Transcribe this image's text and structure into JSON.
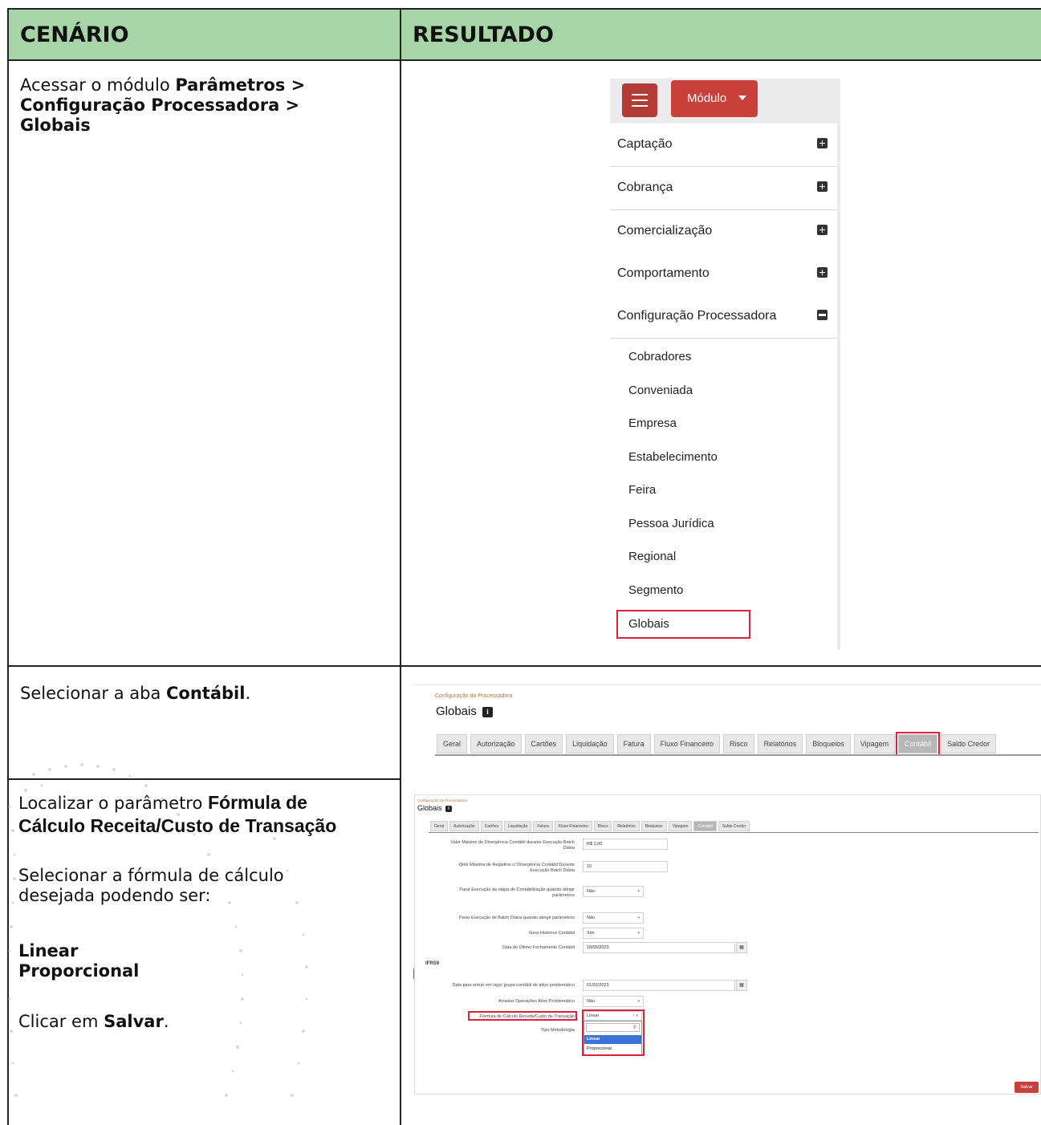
{
  "headers": {
    "scenario": "CENÁRIO",
    "result": "RESULTADO"
  },
  "rows": [
    {
      "instruction": {
        "prefix": "Acessar o módulo ",
        "bold_path": [
          "Parâmetros >",
          "Configuração Processadora >",
          "Globais"
        ]
      }
    },
    {
      "instruction": {
        "prefix": "Selecionar a aba ",
        "bold": "Contábil",
        "suffix": "."
      }
    },
    {
      "instruction": {
        "line1_prefix": "Localizar o parâmetro ",
        "line1_bold": "Fórmula de",
        "line2_bold": "Cálculo Receita/Custo de Transação",
        "select_text_1": "Selecionar a fórmula de cálculo",
        "select_text_2": "desejada podendo ser:",
        "options": [
          "Linear",
          "Proporcional"
        ],
        "click_prefix": "Clicar em ",
        "click_bold": "Salvar",
        "click_suffix": "."
      }
    }
  ],
  "menu": {
    "module_button": "Módulo",
    "items": [
      {
        "label": "Captação",
        "state": "plus"
      },
      {
        "label": "Cobrança",
        "state": "plus"
      },
      {
        "label": "Comercialização",
        "state": "plus"
      },
      {
        "label": "Comportamento",
        "state": "plus"
      },
      {
        "label": "Configuração Processadora",
        "state": "minus"
      }
    ],
    "subitems": [
      "Cobradores",
      "Conveniada",
      "Empresa",
      "Estabelecimento",
      "Feira",
      "Pessoa Jurídica",
      "Regional",
      "Segmento",
      "Globais"
    ],
    "highlighted": "Globais"
  },
  "page": {
    "breadcrumb": "Configuração da Processadora",
    "title": "Globais",
    "info_icon": "i",
    "tabs": [
      "Geral",
      "Autorização",
      "Cartões",
      "Liquidação",
      "Fatura",
      "Fluxo Financeiro",
      "Risco",
      "Relatórios",
      "Bloqueios",
      "Vipagem",
      "Contábil",
      "Saldo Credor"
    ],
    "active_tab": "Contábil"
  },
  "form": {
    "fields": [
      {
        "label_1": "Valor Máximo de Divergência Contábil durante Execução Batch",
        "label_2": "Diária",
        "value": "R$ 1,00"
      },
      {
        "label_1": "Qtde Máxima de Registros c/ Divergência Contábil Durante",
        "label_2": "Execução Batch Diária",
        "value": "10"
      },
      {
        "label_1": "Parar Execução da etapa de Contabilização quando atingir",
        "label_2": "parâmetros",
        "value": "Não"
      },
      {
        "label_1": "Parar Execução de Batch Diária quando atingir parâmetros",
        "label_2": "",
        "value": "Não"
      },
      {
        "label_1": "Gera Histórico Contábil",
        "label_2": "",
        "value": "Sim"
      },
      {
        "label_1": "Data do Último Fechamento Contábil",
        "label_2": "",
        "value": "18/05/2023"
      }
    ],
    "section": "IFRS9",
    "ifrs_fields": [
      {
        "label": "Data para entrar em vigor grupo contábil de ativo problemático",
        "value": "01/01/2023"
      },
      {
        "label": "Arrastar Operações Ativo Problemático",
        "value": "Não"
      },
      {
        "label": "Fórmula de Cálculo Receita/Custo de Transação",
        "value": "Linear"
      },
      {
        "label": "Tipo Metodologia",
        "value": ""
      }
    ],
    "dropdown_options": [
      "Linear",
      "Proporcional"
    ],
    "save_button": "Salvar"
  }
}
